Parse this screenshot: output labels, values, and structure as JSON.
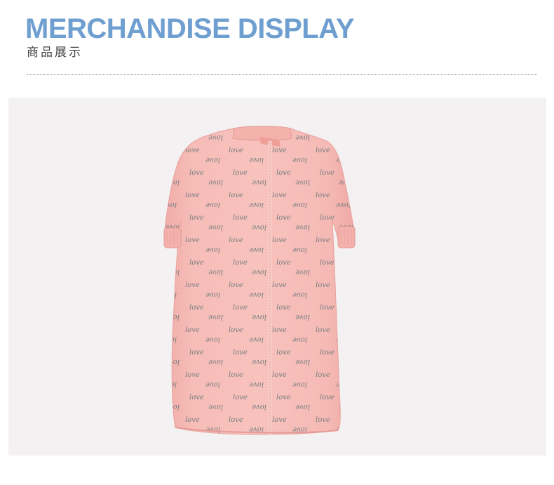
{
  "header": {
    "title": "MERCHANDISE DISPLAY",
    "subtitle": "商品展示"
  },
  "product": {
    "image_description": "pink long-sleeve baby sleep sack with front zipper and grey love script print",
    "print_text": "love",
    "colors": {
      "fabric": "#f5b8b4",
      "print": "#6f7a7c",
      "background": "#f3f1f1",
      "title": "#6f9fd0"
    }
  }
}
